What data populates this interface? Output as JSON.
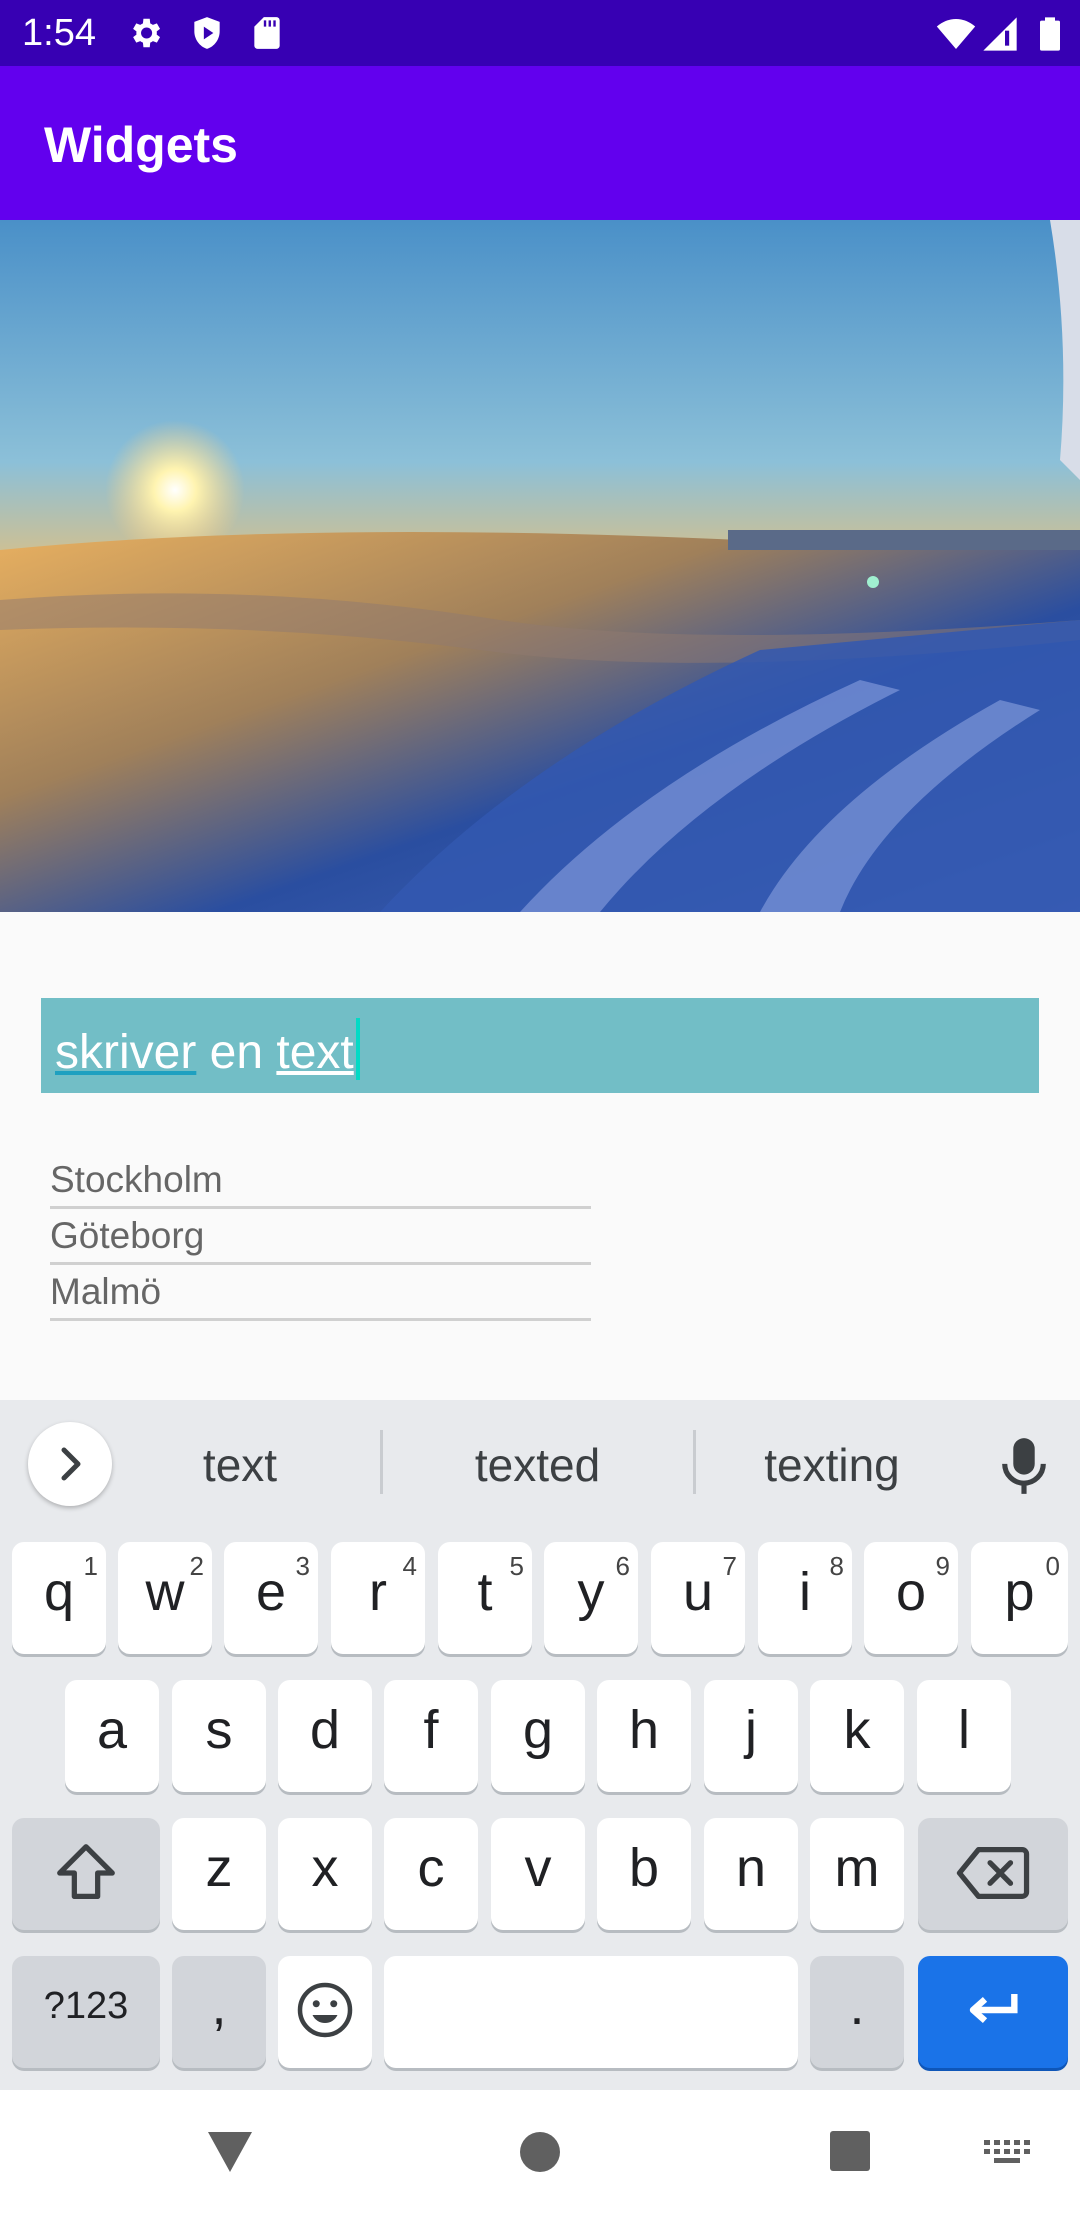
{
  "status_bar": {
    "time": "1:54"
  },
  "app_bar": {
    "title": "Widgets"
  },
  "edit_text": {
    "value_word1": "skriver",
    "value_word2": " en ",
    "value_word3": "text"
  },
  "cities": [
    "Stockholm",
    "Göteborg",
    "Malmö"
  ],
  "keyboard": {
    "suggestions": [
      "text",
      "texted",
      "texting"
    ],
    "row1": [
      {
        "key": "q",
        "sup": "1"
      },
      {
        "key": "w",
        "sup": "2"
      },
      {
        "key": "e",
        "sup": "3"
      },
      {
        "key": "r",
        "sup": "4"
      },
      {
        "key": "t",
        "sup": "5"
      },
      {
        "key": "y",
        "sup": "6"
      },
      {
        "key": "u",
        "sup": "7"
      },
      {
        "key": "i",
        "sup": "8"
      },
      {
        "key": "o",
        "sup": "9"
      },
      {
        "key": "p",
        "sup": "0"
      }
    ],
    "row2": [
      "a",
      "s",
      "d",
      "f",
      "g",
      "h",
      "j",
      "k",
      "l"
    ],
    "row3": [
      "z",
      "x",
      "c",
      "v",
      "b",
      "n",
      "m"
    ],
    "symbols_label": "?123",
    "comma": ",",
    "period": "."
  },
  "colors": {
    "status_bar": "#3700b3",
    "app_bar": "#6200ee",
    "edit_background": "#72bec6",
    "cursor": "#03dac5",
    "enter_key": "#1a73e8"
  },
  "icons": {
    "status_left": [
      "gear-icon",
      "play-shield-icon",
      "sd-card-icon"
    ],
    "status_right": [
      "wifi-icon",
      "signal-icon",
      "battery-icon"
    ],
    "keyboard": [
      "chevron-right-icon",
      "mic-icon",
      "shift-icon",
      "backspace-icon",
      "emoji-icon",
      "enter-icon"
    ],
    "nav": [
      "back-triangle-icon",
      "home-circle-icon",
      "recents-square-icon",
      "keyboard-switch-icon"
    ]
  }
}
